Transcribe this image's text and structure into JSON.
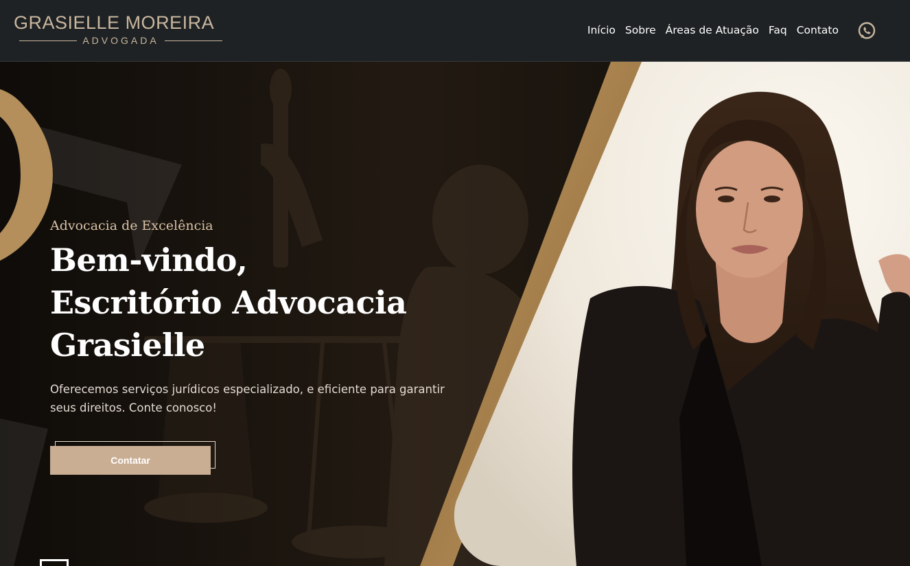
{
  "brand": {
    "name": "GRASIELLE MOREIRA",
    "subtitle": "ADVOGADA",
    "gold": "#c9b79f"
  },
  "nav": {
    "items": [
      {
        "label": "Início"
      },
      {
        "label": "Sobre"
      },
      {
        "label": "Áreas de Atuação"
      },
      {
        "label": "Faq"
      },
      {
        "label": "Contato"
      }
    ],
    "whatsapp_icon": "whatsapp-icon"
  },
  "hero": {
    "eyebrow": "Advocacia de Excelência",
    "headline_lines": [
      "Bem-vindo,",
      "Escritório Advocacia",
      "Grasielle"
    ],
    "subtitle": "Oferecemos serviços jurídicos especializado, e eficiente para garantir seus direitos. Conte conosco!",
    "cta_label": "Contatar",
    "cta_color": "#c9ae93",
    "accent_color": "#b48f5c"
  }
}
